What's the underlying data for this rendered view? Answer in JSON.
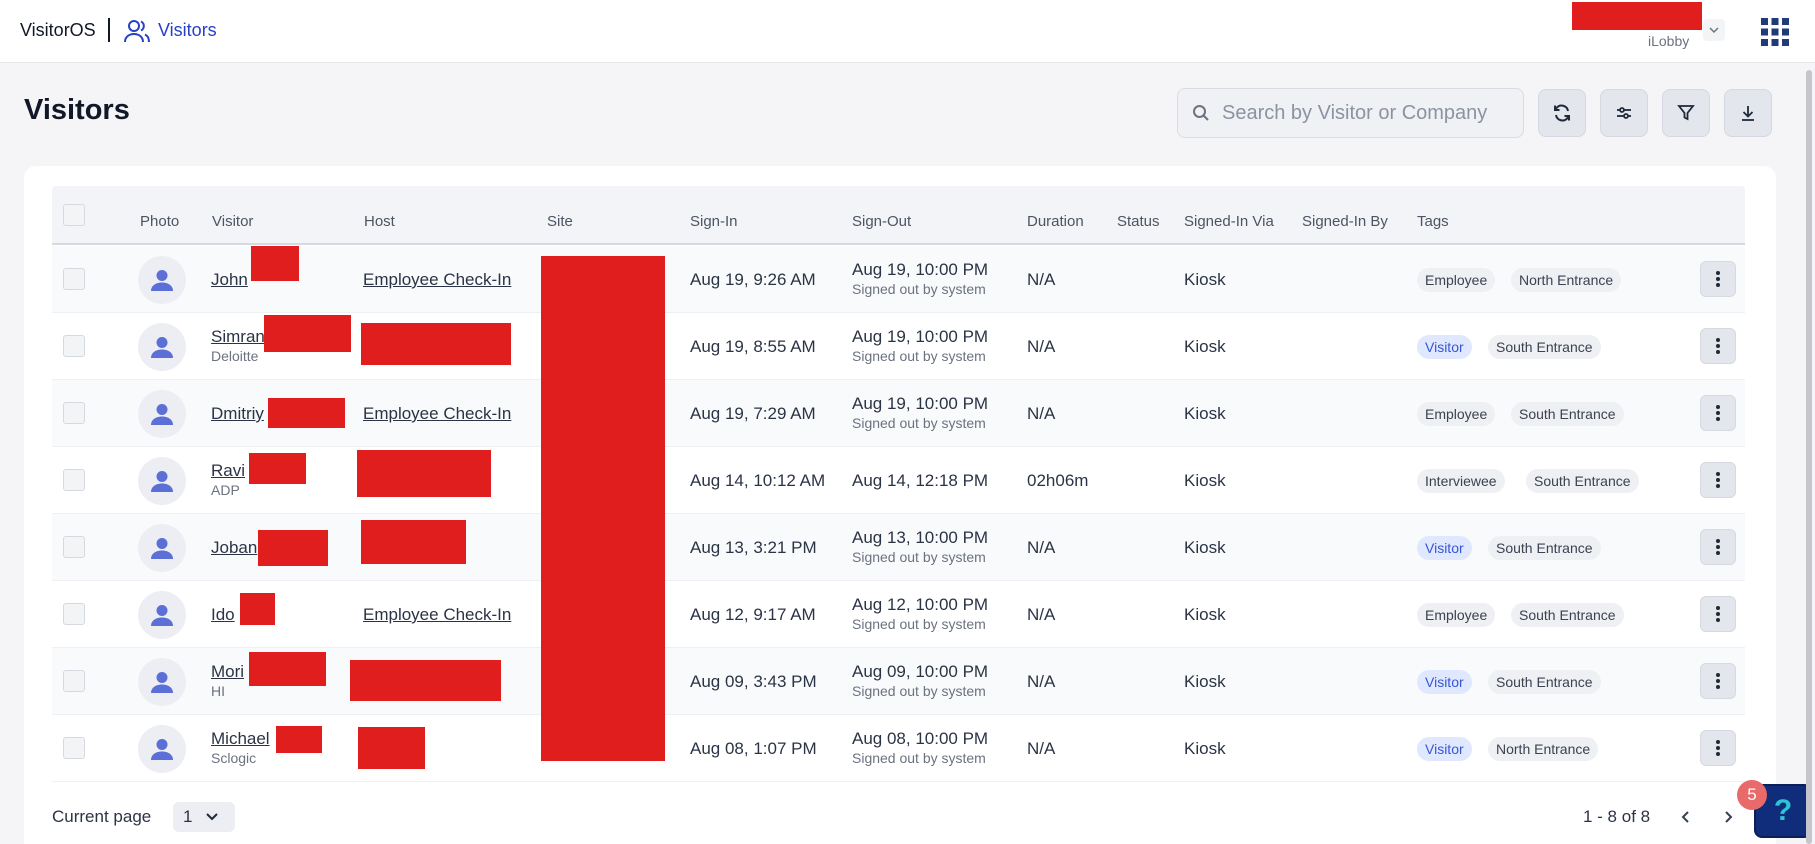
{
  "header": {
    "brand": "VisitorOS",
    "section": "Visitors",
    "company": "iLobby"
  },
  "page": {
    "title": "Visitors",
    "search_placeholder": "Search by Visitor or Company"
  },
  "table": {
    "columns": [
      "Photo",
      "Visitor",
      "Host",
      "Site",
      "Sign-In",
      "Sign-Out",
      "Duration",
      "Status",
      "Signed-In Via",
      "Signed-In By",
      "Tags"
    ],
    "rows": [
      {
        "visitor": "John",
        "company": "",
        "host": "Employee Check-In",
        "sign_in": "Aug 19, 9:26 AM",
        "sign_out": "Aug 19, 10:00 PM",
        "sign_out_note": "Signed out by system",
        "duration": "N/A",
        "via": "Kiosk",
        "tags": [
          {
            "label": "Employee",
            "kind": "grey"
          },
          {
            "label": "North Entrance",
            "kind": "grey"
          }
        ]
      },
      {
        "visitor": "Simran",
        "company": "Deloitte",
        "host": "",
        "sign_in": "Aug 19, 8:55 AM",
        "sign_out": "Aug 19, 10:00 PM",
        "sign_out_note": "Signed out by system",
        "duration": "N/A",
        "via": "Kiosk",
        "tags": [
          {
            "label": "Visitor",
            "kind": "blue"
          },
          {
            "label": "South Entrance",
            "kind": "grey"
          }
        ]
      },
      {
        "visitor": "Dmitriy",
        "company": "",
        "host": "Employee Check-In",
        "sign_in": "Aug 19, 7:29 AM",
        "sign_out": "Aug 19, 10:00 PM",
        "sign_out_note": "Signed out by system",
        "duration": "N/A",
        "via": "Kiosk",
        "tags": [
          {
            "label": "Employee",
            "kind": "grey"
          },
          {
            "label": "South Entrance",
            "kind": "grey"
          }
        ]
      },
      {
        "visitor": "Ravi",
        "company": "ADP",
        "host": "",
        "sign_in": "Aug 14, 10:12 AM",
        "sign_out": "Aug 14, 12:18 PM",
        "sign_out_note": "",
        "duration": "02h06m",
        "via": "Kiosk",
        "tags": [
          {
            "label": "Interviewee",
            "kind": "grey"
          },
          {
            "label": "South Entrance",
            "kind": "grey"
          }
        ]
      },
      {
        "visitor": "Joban",
        "company": "",
        "host": "",
        "sign_in": "Aug 13, 3:21 PM",
        "sign_out": "Aug 13, 10:00 PM",
        "sign_out_note": "Signed out by system",
        "duration": "N/A",
        "via": "Kiosk",
        "tags": [
          {
            "label": "Visitor",
            "kind": "blue"
          },
          {
            "label": "South Entrance",
            "kind": "grey"
          }
        ]
      },
      {
        "visitor": "Ido",
        "company": "",
        "host": "Employee Check-In",
        "sign_in": "Aug 12, 9:17 AM",
        "sign_out": "Aug 12, 10:00 PM",
        "sign_out_note": "Signed out by system",
        "duration": "N/A",
        "via": "Kiosk",
        "tags": [
          {
            "label": "Employee",
            "kind": "grey"
          },
          {
            "label": "South Entrance",
            "kind": "grey"
          }
        ]
      },
      {
        "visitor": "Mori",
        "company": "HI",
        "host": "",
        "sign_in": "Aug 09, 3:43 PM",
        "sign_out": "Aug 09, 10:00 PM",
        "sign_out_note": "Signed out by system",
        "duration": "N/A",
        "via": "Kiosk",
        "tags": [
          {
            "label": "Visitor",
            "kind": "blue"
          },
          {
            "label": "South Entrance",
            "kind": "grey"
          }
        ]
      },
      {
        "visitor": "Michael",
        "company": "Sclogic",
        "host": "",
        "sign_in": "Aug 08, 1:07 PM",
        "sign_out": "Aug 08, 10:00 PM",
        "sign_out_note": "Signed out by system",
        "duration": "N/A",
        "via": "Kiosk",
        "tags": [
          {
            "label": "Visitor",
            "kind": "blue"
          },
          {
            "label": "North Entrance",
            "kind": "grey"
          }
        ]
      }
    ]
  },
  "footer": {
    "current_page_label": "Current page",
    "current_page": "1",
    "range": "1 - 8 of 8"
  },
  "help": {
    "label": "?",
    "badge": "5"
  },
  "colors": {
    "accent": "#2741c7",
    "redaction": "#e01e1e",
    "visitor_tag_bg": "#e0e8ff",
    "help_button": "#0f2d7a"
  },
  "icons": [
    "people-icon",
    "chevron-down-icon",
    "apps-grid-icon",
    "search-icon",
    "refresh-icon",
    "sliders-icon",
    "filter-icon",
    "download-icon",
    "person-icon",
    "more-vertical-icon",
    "chevron-left-icon",
    "chevron-right-icon",
    "help-icon"
  ]
}
